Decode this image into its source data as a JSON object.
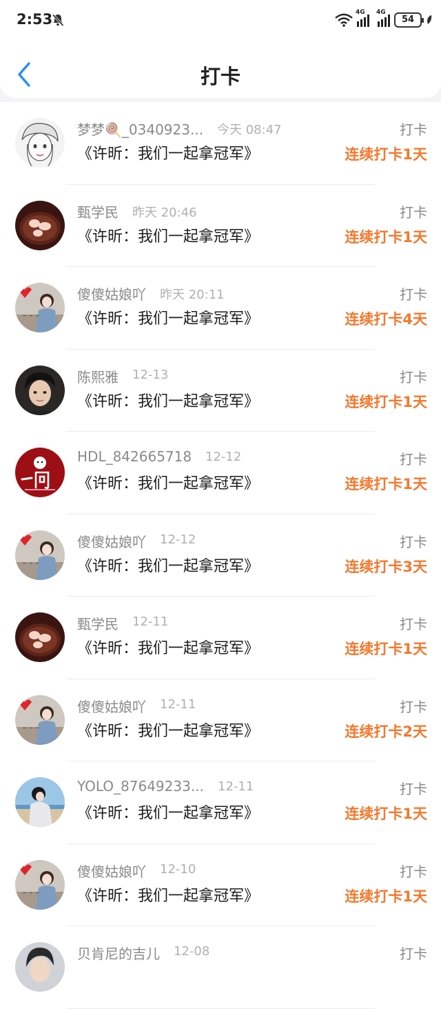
{
  "status": {
    "time": "2:53",
    "signal1_label": "4G",
    "signal2_label": "4G",
    "battery": "54"
  },
  "header": {
    "title": "打卡"
  },
  "items": [
    {
      "name": "梦梦🍭_0340923...",
      "time": "今天 08:47",
      "label": "打卡",
      "book": "《许昕：我们一起拿冠军》",
      "streak": "连续打卡1天",
      "avatar": "sketch-girl"
    },
    {
      "name": "甄学民",
      "time": "昨天 20:46",
      "label": "打卡",
      "book": "《许昕：我们一起拿冠军》",
      "streak": "连续打卡1天",
      "avatar": "cocoa-cup"
    },
    {
      "name": "傻傻姑娘吖",
      "time": "昨天 20:11",
      "label": "打卡",
      "book": "《许昕：我们一起拿冠军》",
      "streak": "连续打卡4天",
      "avatar": "girl-photo"
    },
    {
      "name": "陈熙雅",
      "time": "12-13",
      "label": "打卡",
      "book": "《许昕：我们一起拿冠军》",
      "streak": "连续打卡1天",
      "avatar": "boy-portrait"
    },
    {
      "name": "HDL_842665718",
      "time": "12-12",
      "label": "打卡",
      "book": "《许昕：我们一起拿冠军》",
      "streak": "连续打卡1天",
      "avatar": "red-calligraphy"
    },
    {
      "name": "傻傻姑娘吖",
      "time": "12-12",
      "label": "打卡",
      "book": "《许昕：我们一起拿冠军》",
      "streak": "连续打卡3天",
      "avatar": "girl-photo"
    },
    {
      "name": "甄学民",
      "time": "12-11",
      "label": "打卡",
      "book": "《许昕：我们一起拿冠军》",
      "streak": "连续打卡1天",
      "avatar": "cocoa-cup"
    },
    {
      "name": "傻傻姑娘吖",
      "time": "12-11",
      "label": "打卡",
      "book": "《许昕：我们一起拿冠军》",
      "streak": "连续打卡2天",
      "avatar": "girl-photo"
    },
    {
      "name": "YOLO_87649233...",
      "time": "12-11",
      "label": "打卡",
      "book": "《许昕：我们一起拿冠军》",
      "streak": "连续打卡1天",
      "avatar": "beach-girl"
    },
    {
      "name": "傻傻姑娘吖",
      "time": "12-10",
      "label": "打卡",
      "book": "《许昕：我们一起拿冠军》",
      "streak": "连续打卡1天",
      "avatar": "girl-photo"
    },
    {
      "name": "贝肯尼的吉儿",
      "time": "12-08",
      "label": "打卡",
      "book": "",
      "streak": "",
      "avatar": "boy-photo"
    }
  ]
}
